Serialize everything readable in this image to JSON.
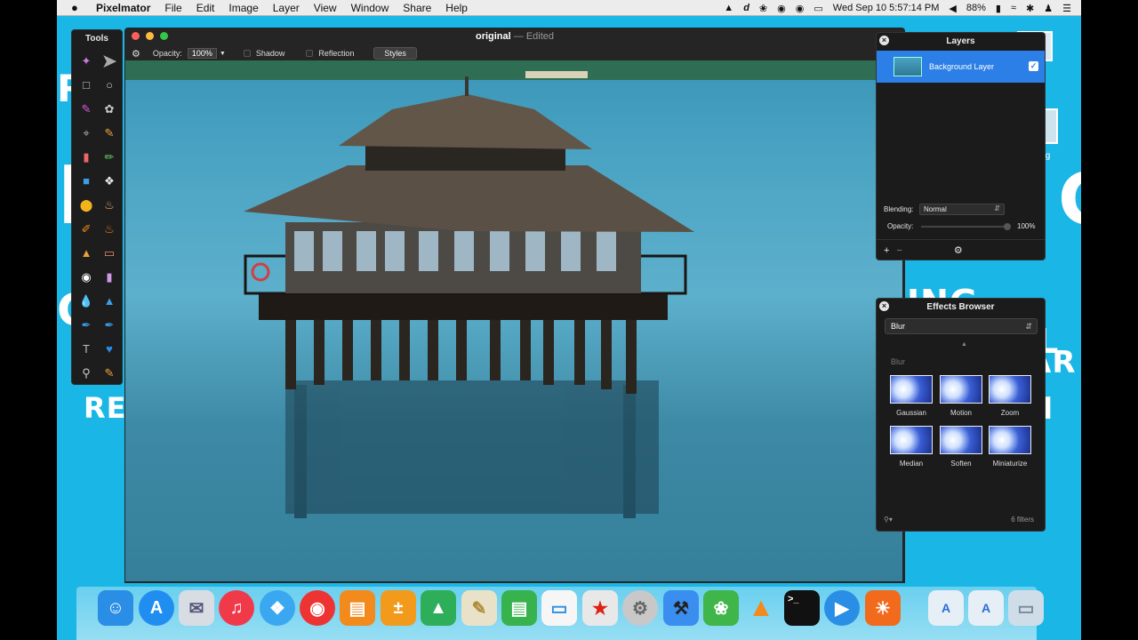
{
  "menubar": {
    "app_name": "Pixelmator",
    "menus": [
      "File",
      "Edit",
      "Image",
      "Layer",
      "View",
      "Window",
      "Share",
      "Help"
    ],
    "clock": "Wed Sep 10  5:57:14 PM",
    "battery": "88%"
  },
  "tools": {
    "title": "Tools"
  },
  "document": {
    "title": "original",
    "separator": "—",
    "status": "Edited",
    "opacity_label": "Opacity:",
    "opacity_value": "100%",
    "shadow_label": "Shadow",
    "reflection_label": "Reflection",
    "styles_label": "Styles"
  },
  "layers_panel": {
    "title": "Layers",
    "layer_name": "Background Layer",
    "blending_label": "Blending:",
    "blending_value": "Normal",
    "opacity_label": "Opacity:",
    "opacity_value": "100%"
  },
  "effects_panel": {
    "title": "Effects Browser",
    "category": "Blur",
    "section_label": "Blur",
    "effects": [
      "Gaussian",
      "Motion",
      "Zoom",
      "Median",
      "Soften",
      "Miniaturize"
    ],
    "filter_count": "6 filters"
  },
  "desktop": {
    "file_label": "jpg"
  },
  "colors": {
    "desktop": "#19b6e6",
    "selection": "#2c7fe6",
    "panel": "#1b1b1b"
  }
}
